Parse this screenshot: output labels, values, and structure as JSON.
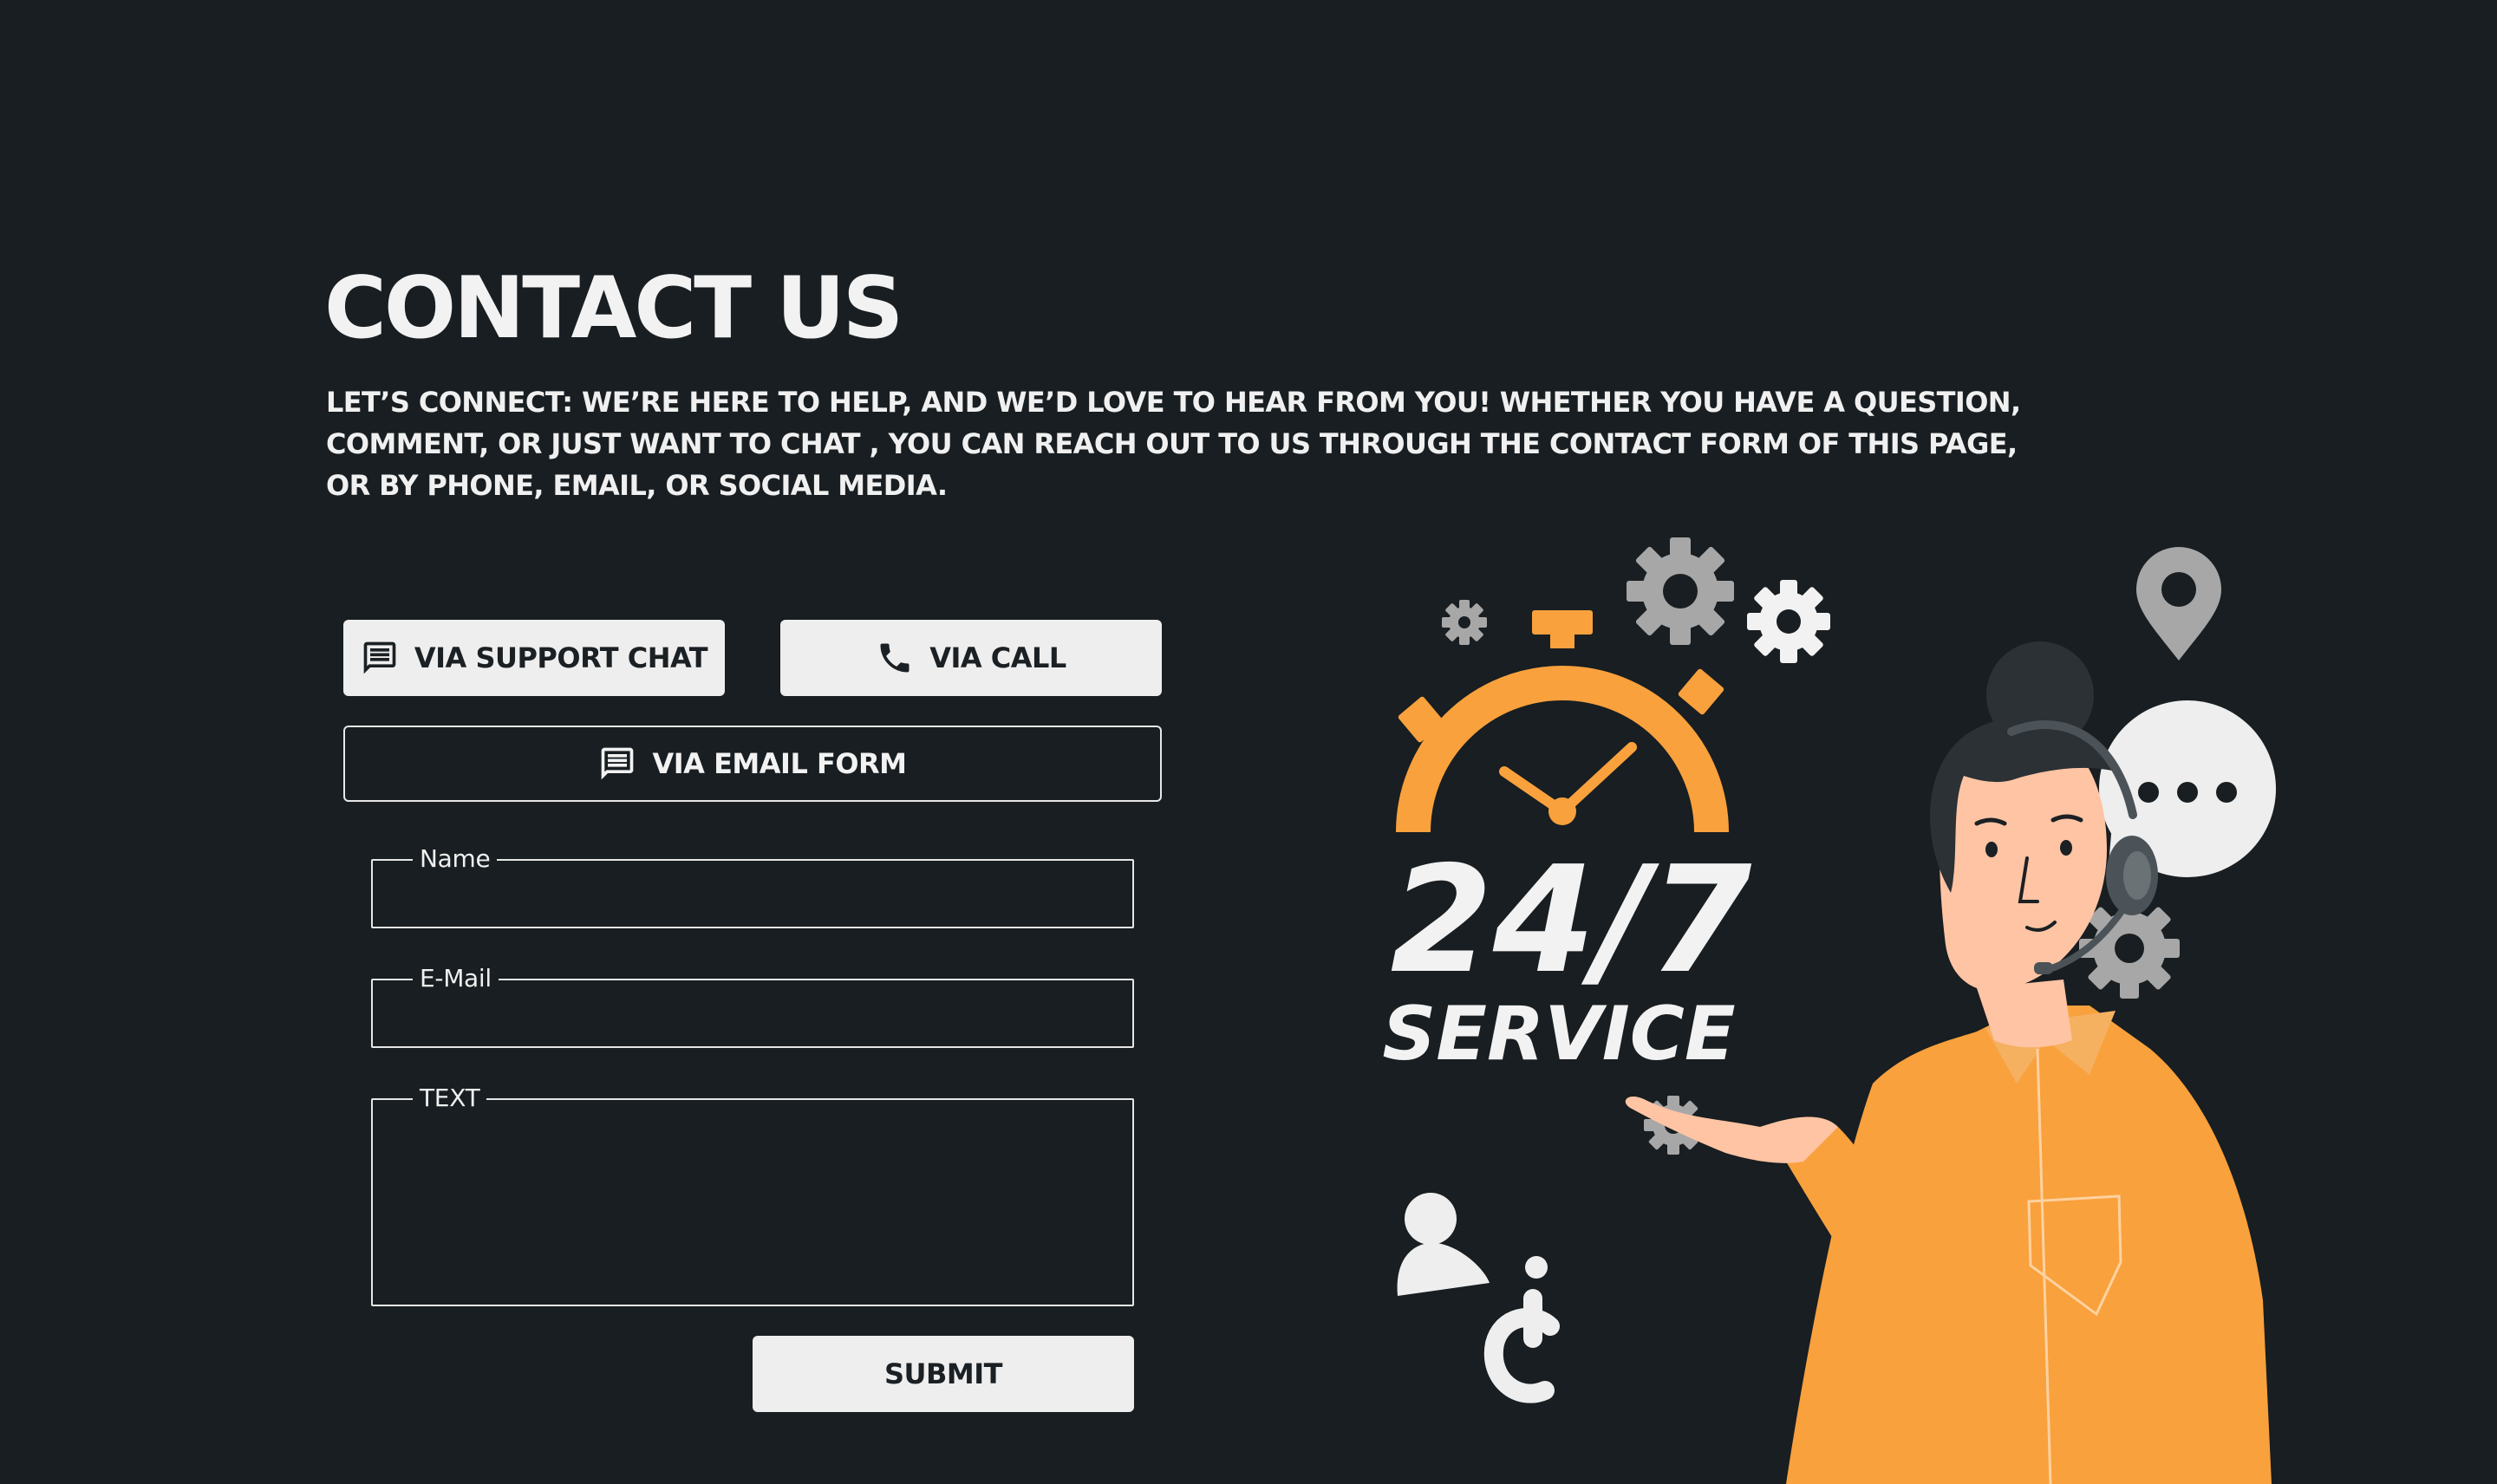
{
  "header": {
    "title": "CONTACT US",
    "intro": "LET’S CONNECT: WE’RE HERE TO HELP, AND WE’D LOVE TO HEAR FROM YOU! WHETHER YOU HAVE A QUESTION, COMMENT, OR JUST WANT TO CHAT , YOU CAN REACH OUT TO US THROUGH THE CONTACT FORM OF THIS PAGE, OR BY PHONE, EMAIL, OR SOCIAL MEDIA."
  },
  "contact_options": {
    "support_chat": {
      "label": "VIA SUPPORT CHAT",
      "icon": "chat-icon"
    },
    "call": {
      "label": "VIA CALL",
      "icon": "phone-icon"
    },
    "email_form": {
      "label": "VIA EMAIL FORM",
      "icon": "chat-icon"
    }
  },
  "form": {
    "name": {
      "label": "Name",
      "value": ""
    },
    "email": {
      "label": "E-Mail",
      "value": ""
    },
    "text": {
      "label": "TEXT",
      "value": ""
    },
    "submit_label": "SUBMIT"
  },
  "illustration": {
    "headline": "24/7",
    "subheadline": "SERVICE",
    "icons": [
      "stopwatch-icon",
      "gear-icon",
      "location-pin-icon",
      "speech-bubble-icon",
      "user-icon",
      "question-mark-icon"
    ]
  },
  "colors": {
    "background": "#181e21",
    "text": "#f0f0f0",
    "button_light": "#eeeeee",
    "accent": "#f9a13d",
    "skin": "#ffc4a3",
    "gray_icon": "#a7a7a7"
  }
}
